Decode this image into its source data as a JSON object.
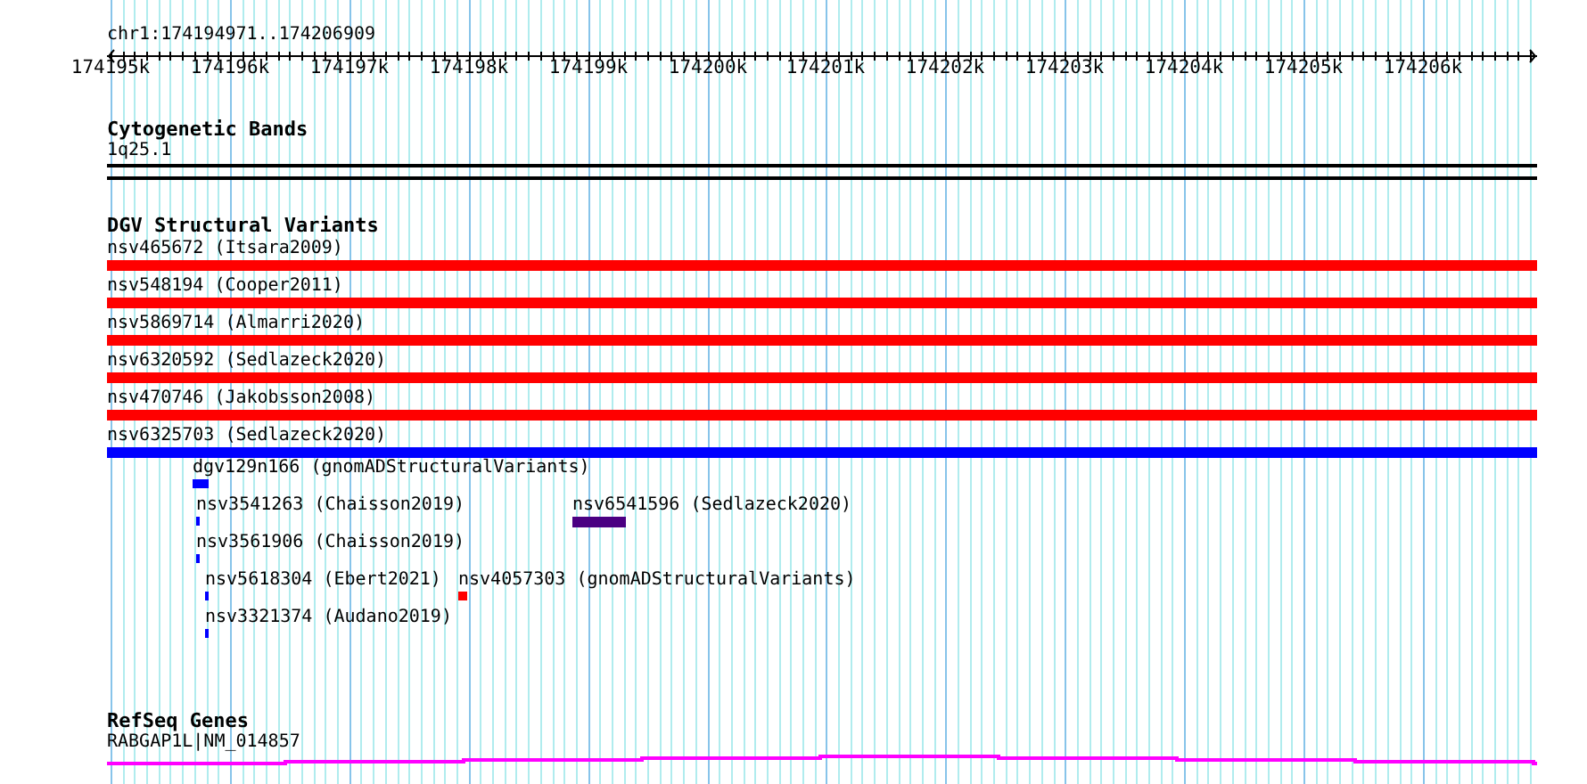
{
  "ruler": {
    "location": "chr1:174194971..174206909",
    "ticks": [
      "174195k",
      "174196k",
      "174197k",
      "174198k",
      "174199k",
      "174200k",
      "174201k",
      "174202k",
      "174203k",
      "174204k",
      "174205k",
      "174206k"
    ]
  },
  "tracks": [
    {
      "kind": "bands",
      "title": "Cytogenetic Bands",
      "features": [
        {
          "label": "1q25.1"
        }
      ]
    },
    {
      "kind": "variants",
      "title": "DGV Structural Variants",
      "features": [
        {
          "label": "nsv465672 (Itsara2009)",
          "color": "#ff0000"
        },
        {
          "label": "nsv548194 (Cooper2011)",
          "color": "#ff0000"
        },
        {
          "label": "nsv5869714 (Almarri2020)",
          "color": "#ff0000"
        },
        {
          "label": "nsv6320592 (Sedlazeck2020)",
          "color": "#ff0000"
        },
        {
          "label": "nsv470746 (Jakobsson2008)",
          "color": "#ff0000"
        },
        {
          "label": "nsv6325703 (Sedlazeck2020)",
          "color": "#0000ff"
        },
        {
          "label": "dgv129n166 (gnomADStructuralVariants)",
          "color": "#0000ff"
        },
        {
          "label": "nsv3541263 (Chaisson2019)",
          "color": "#0000ff"
        },
        {
          "label": "nsv6541596 (Sedlazeck2020)",
          "color": "#4b0082"
        },
        {
          "label": "nsv3561906 (Chaisson2019)",
          "color": "#0000ff"
        },
        {
          "label": "nsv5618304 (Ebert2021)",
          "color": "#0000ff"
        },
        {
          "label": "nsv4057303 (gnomADStructuralVariants)",
          "color": "#ff0000"
        },
        {
          "label": "nsv3321374 (Audano2019)",
          "color": "#0000ff"
        }
      ]
    },
    {
      "kind": "genes",
      "title": "RefSeq Genes",
      "features": [
        {
          "label": "RABGAP1L|NM_014857"
        }
      ]
    }
  ]
}
